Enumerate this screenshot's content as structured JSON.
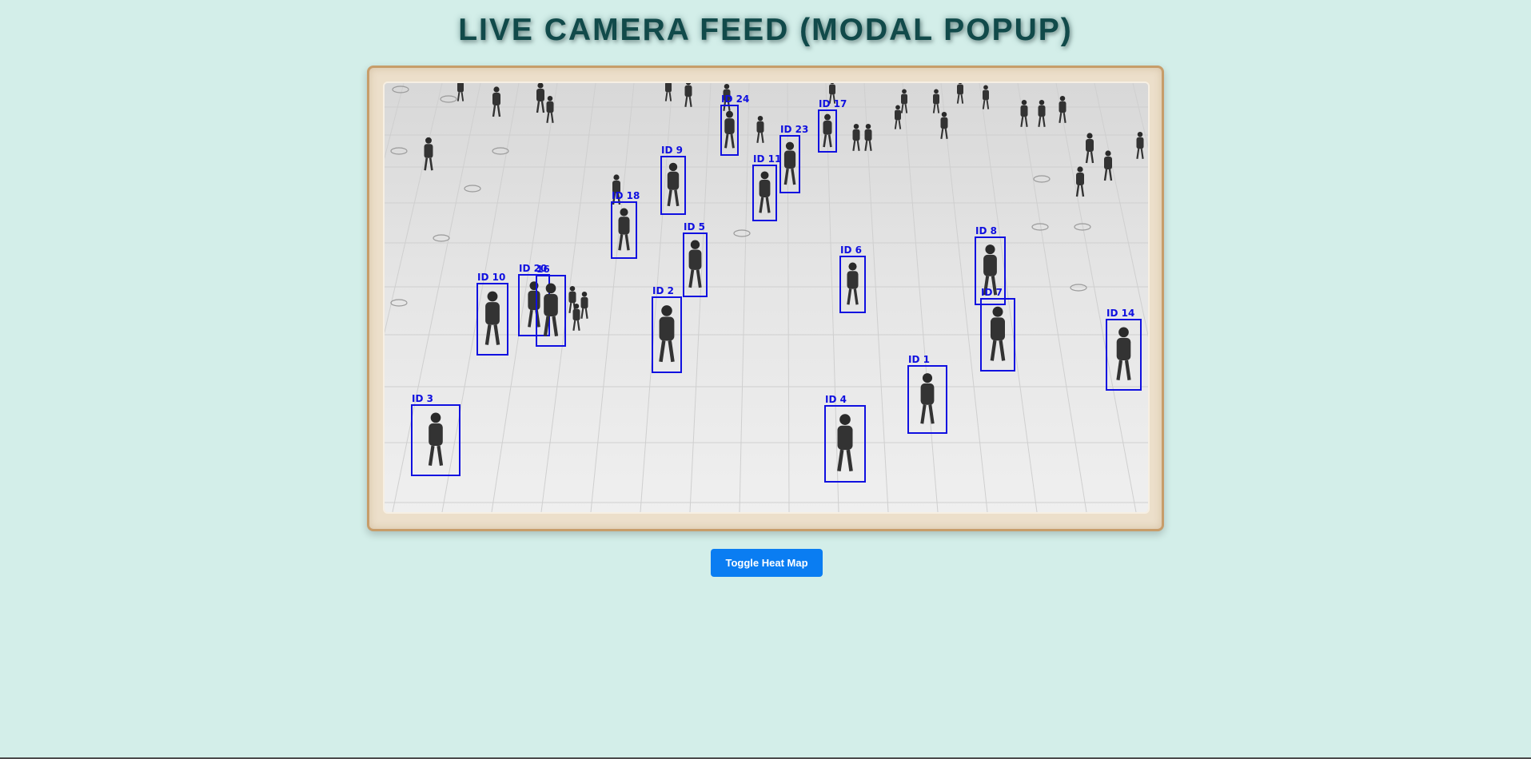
{
  "page": {
    "title": "LIVE CAMERA FEED (MODAL POPUP)",
    "background_color": "#d3eee9",
    "title_color": "#114a4a"
  },
  "feed": {
    "frame_color": "#ecdfca",
    "frame_border_color": "#c79d6a",
    "box_color": "#1010e0",
    "detections": [
      {
        "label": "ID 24"
      },
      {
        "label": "ID 17"
      },
      {
        "label": "ID 23"
      },
      {
        "label": "ID 9"
      },
      {
        "label": "ID 11"
      },
      {
        "label": "ID 18"
      },
      {
        "label": "ID 5"
      },
      {
        "label": "ID 6"
      },
      {
        "label": "ID 8"
      },
      {
        "label": "ID 10"
      },
      {
        "label": "ID 20"
      },
      {
        "label": "16"
      },
      {
        "label": "ID 2"
      },
      {
        "label": "ID 7"
      },
      {
        "label": "ID 14"
      },
      {
        "label": "ID 1"
      },
      {
        "label": "ID 3"
      },
      {
        "label": "ID 4"
      }
    ]
  },
  "controls": {
    "toggle_heatmap_label": "Toggle Heat Map",
    "button_color": "#0a7df2"
  }
}
